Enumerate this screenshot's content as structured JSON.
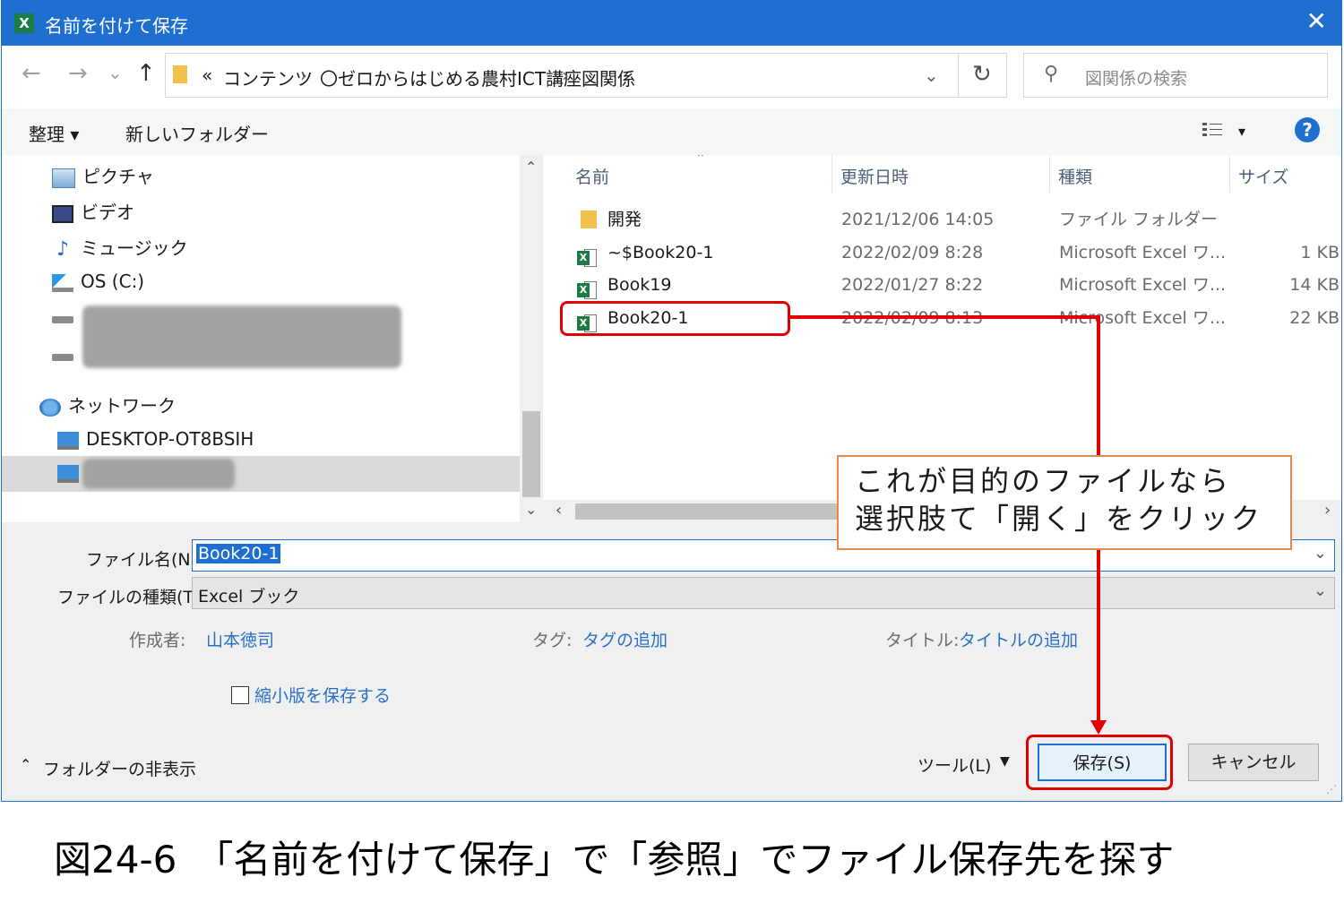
{
  "titlebar": {
    "title": "名前を付けて保存",
    "app_icon": "excel-icon",
    "close": "✕"
  },
  "nav": {
    "back": "←",
    "forward": "→",
    "recent": "⌄",
    "up": "↑",
    "breadcrumb": [
      "コンテンツ",
      "〇ゼロからはじめる農村ICT講座",
      "図関係"
    ],
    "breadcrumb_overflow": "«",
    "refresh": "↻",
    "search_placeholder": "図関係の検索"
  },
  "toolbar": {
    "organize": "整理 ▾",
    "new_folder": "新しいフォルダー",
    "view_caret": "▾",
    "help": "?"
  },
  "sidebar": {
    "items": [
      {
        "label": "ピクチャ",
        "icon": "pictures-icon"
      },
      {
        "label": "ビデオ",
        "icon": "video-icon"
      },
      {
        "label": "ミュージック",
        "icon": "music-icon"
      },
      {
        "label": "OS (C:)",
        "icon": "drive-icon"
      }
    ],
    "network": "ネットワーク",
    "computer": "DESKTOP-OT8BSIH"
  },
  "columns": {
    "name": "名前",
    "date": "更新日時",
    "type": "種類",
    "size": "サイズ"
  },
  "files": [
    {
      "name": "開発",
      "date": "2021/12/06 14:05",
      "type": "ファイル フォルダー",
      "size": "",
      "kind": "folder"
    },
    {
      "name": "~$Book20-1",
      "date": "2022/02/09 8:28",
      "type": "Microsoft Excel ワ...",
      "size": "1 KB",
      "kind": "excel"
    },
    {
      "name": "Book19",
      "date": "2022/01/27 8:22",
      "type": "Microsoft Excel ワ...",
      "size": "14 KB",
      "kind": "excel"
    },
    {
      "name": "Book20-1",
      "date": "2022/02/09 8:13",
      "type": "Microsoft Excel ワ...",
      "size": "22 KB",
      "kind": "excel"
    }
  ],
  "form": {
    "filename_label": "ファイル名(N):",
    "filename_value": "Book20-1",
    "filetype_label": "ファイルの種類(T):",
    "filetype_value": "Excel ブック",
    "author_label": "作成者:",
    "author_value": "山本徳司",
    "tags_label": "タグ:",
    "tags_value": "タグの追加",
    "title_label": "タイトル:",
    "title_value": "タイトルの追加",
    "thumbnail_label": "縮小版を保存する"
  },
  "footer": {
    "hide_folders": "フォルダーの非表示",
    "tools": "ツール(L)",
    "save": "保存(S)",
    "cancel": "キャンセル"
  },
  "annotation": {
    "callout_line1": "これが目的のファイルなら",
    "callout_line2": "選択肢て「開く」をクリック",
    "highlight_color": "#e00000",
    "callout_border_color": "#e08a4c"
  },
  "caption": "図24-6　「名前を付けて保存」で「参照」でファイル保存先を探す"
}
